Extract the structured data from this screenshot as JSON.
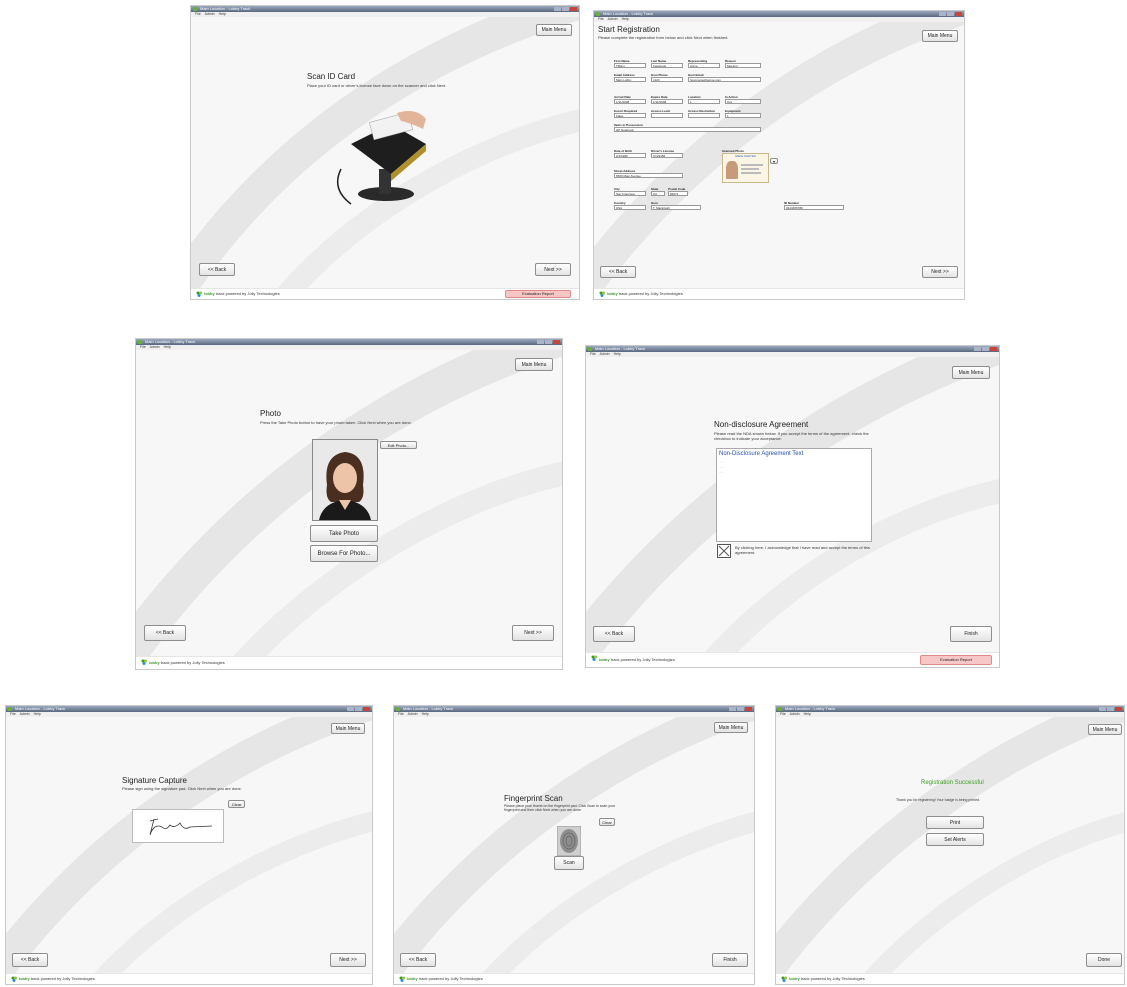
{
  "app": {
    "window_title": "Main Location - Lobby Track",
    "menu": [
      "File",
      "Admin",
      "Help"
    ],
    "main_menu_label": "Main Menu",
    "back_label": "<< Back",
    "next_label": "Next >>",
    "eval_label": "Evaluation Report",
    "footer_brand": "lobby",
    "footer_rest": " track powered by Jolly Technologies",
    "colors": {
      "title_bar": "#58677f",
      "eval_bg": "#f7c6c6",
      "success_green": "#3a9d1f",
      "brand_green": "#3b9a2c",
      "link_blue": "#2a4fb0"
    }
  },
  "scan_id": {
    "title": "Scan ID Card",
    "desc": "Place your ID card or driver's license face down on the scanner and click Next."
  },
  "registration": {
    "title": "Start Registration",
    "desc": "Please complete the registration form below and click Next when finished.",
    "fields": [
      {
        "label": "First Name",
        "value": "Tiffany"
      },
      {
        "label": "Last Name",
        "value": "Facebook"
      },
      {
        "label": "Representing",
        "value": "Acme"
      },
      {
        "label": "Reason",
        "value": "Meeting"
      },
      {
        "label": "Email Address",
        "value": "Main Lobby"
      },
      {
        "label": "Host Phone",
        "value": "x123"
      },
      {
        "label": "Host Email",
        "value": "host.name@acme.com"
      },
      {
        "label": "Arrival Date",
        "value": "1/11/2008"
      },
      {
        "label": "Expire Date",
        "value": "1/11/2008"
      },
      {
        "label": "Location",
        "value": "1"
      },
      {
        "label": "In Action",
        "value": "Out"
      },
      {
        "label": "Escort Required",
        "value": "False"
      },
      {
        "label": "Access Level",
        "value": ""
      },
      {
        "label": "Access Restriction",
        "value": ""
      },
      {
        "label": "Equipment",
        "value": "1"
      },
      {
        "label": "Items in Possession",
        "value": "HP Notebook"
      },
      {
        "label": "Date of Birth",
        "value": "2/1/1980"
      },
      {
        "label": "Driver's License",
        "value": "C123456"
      },
      {
        "label": "Street Address",
        "value": "6500 Main Avenue"
      },
      {
        "label": "City",
        "value": "San Francisco"
      },
      {
        "label": "State",
        "value": "CA"
      },
      {
        "label": "Postal Code",
        "value": "94071"
      },
      {
        "label": "Country",
        "value": "USA"
      },
      {
        "label": "Host",
        "value": "T. Macintosh"
      },
      {
        "label": "ID Number",
        "value": "0123456789"
      }
    ],
    "scanned_photo_label": "Scanned Photo",
    "card_text": "Maria Ciotti Sitl"
  },
  "photo": {
    "title": "Photo",
    "desc": "Press the Take Photo button to have your photo taken. Click Next when you are done.",
    "edit_label": "Edit Photo...",
    "take_label": "Take Photo",
    "browse_label": "Browse For Photo..."
  },
  "nda": {
    "title": "Non-disclosure Agreement",
    "desc": "Please read the NDA shown below. If you accept the terms of the agreement, check the checkbox to indicate your acceptance.",
    "box_title": "Non-Disclosure Agreement Text",
    "box_lines": [
      "....",
      "....",
      "...."
    ],
    "accept_text": "By clicking here, I acknowledge that I have read and accept the terms of this agreement.",
    "finish_label": "Finish"
  },
  "signature": {
    "title": "Signature Capture",
    "desc": "Please sign using the signature pad. Click Next when you are done.",
    "clear_label": "Clear"
  },
  "fingerprint": {
    "title": "Fingerprint Scan",
    "desc": "Please place your thumb on the fingerprint pad. Click Scan to scan your fingerprint and then click Next when you are done.",
    "clear_label": "Clear",
    "scan_label": "Scan",
    "finish_label": "Finish"
  },
  "success": {
    "title": "Registration Successful",
    "desc": "Thank you for registering! Your badge is being printed.",
    "print_label": "Print",
    "alerts_label": "Set Alerts",
    "done_label": "Done"
  }
}
